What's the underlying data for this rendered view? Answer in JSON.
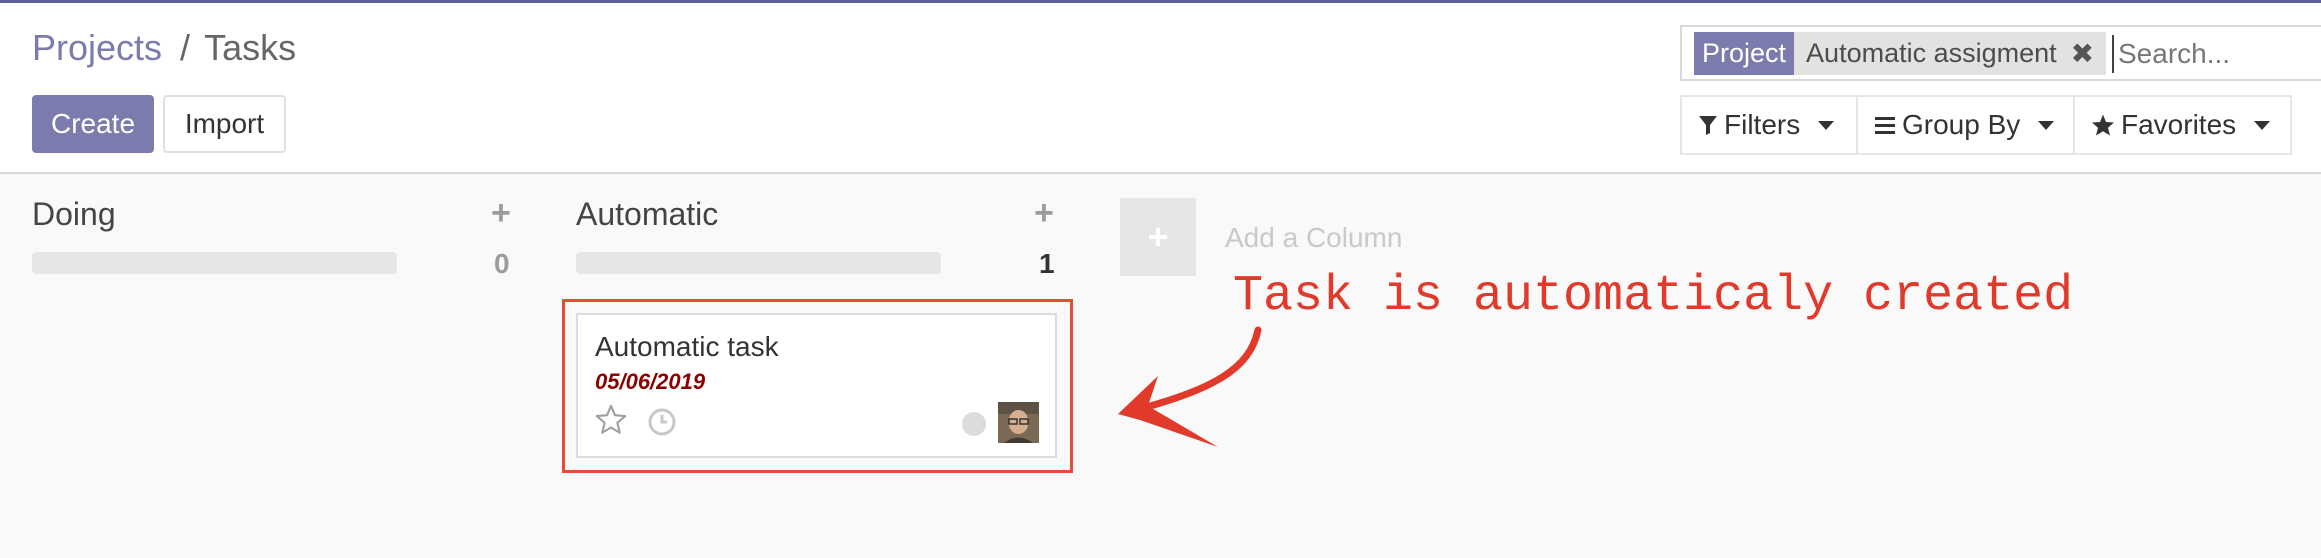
{
  "breadcrumb": {
    "parent": "Projects",
    "separator": "/",
    "current": "Tasks"
  },
  "buttons": {
    "create": "Create",
    "import": "Import"
  },
  "search": {
    "facet_category": "Project",
    "facet_value": "Automatic assigment",
    "facet_remove": "✖",
    "placeholder": "Search..."
  },
  "dropdowns": {
    "filters": "Filters",
    "group_by": "Group By",
    "favorites": "Favorites"
  },
  "kanban": {
    "columns": [
      {
        "title": "Doing",
        "add": "+",
        "count": "0"
      },
      {
        "title": "Automatic",
        "add": "+",
        "count": "1"
      }
    ],
    "add_column": {
      "icon": "+",
      "label": "Add a Column"
    },
    "card": {
      "title": "Automatic task",
      "date": "05/06/2019"
    }
  },
  "annotation": {
    "text": "Task is automaticaly created",
    "color": "#e1392a"
  },
  "colors": {
    "brand": "#7c7bad",
    "overdue_date": "#8b0000"
  }
}
